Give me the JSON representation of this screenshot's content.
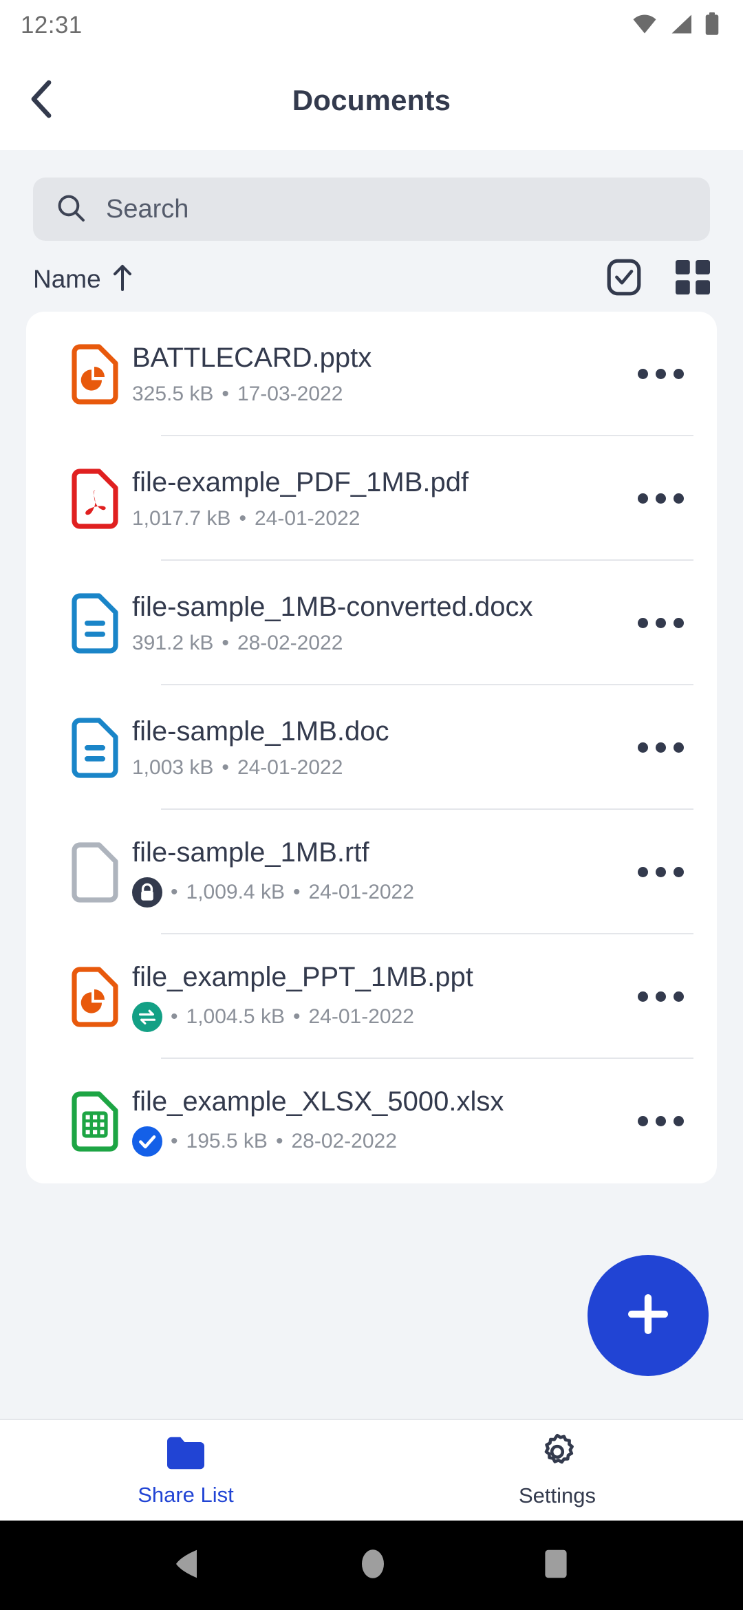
{
  "status_bar": {
    "time": "12:31",
    "icons": [
      "wifi-icon",
      "cellular-signal-icon",
      "battery-icon"
    ]
  },
  "app_bar": {
    "back_icon": "chevron-left-icon",
    "title": "Documents"
  },
  "search": {
    "icon": "search-icon",
    "placeholder": "Search",
    "value": ""
  },
  "sort_row": {
    "label": "Name",
    "direction_icon": "arrow-up-icon",
    "select_icon": "checkbox-select-icon",
    "view_icon": "grid-view-icon"
  },
  "files": [
    {
      "name": "BATTLECARD.pptx",
      "size": "325.5 kB",
      "separator": "•",
      "date": "17-03-2022",
      "icon": "powerpoint-file-icon",
      "icon_color": "#E8590C",
      "badge": null,
      "more_icon": "more-options-icon"
    },
    {
      "name": "file-example_PDF_1MB.pdf",
      "size": "1,017.7 kB",
      "separator": "•",
      "date": "24-01-2022",
      "icon": "pdf-file-icon",
      "icon_color": "#E02020",
      "badge": null,
      "more_icon": "more-options-icon"
    },
    {
      "name": "file-sample_1MB-converted.docx",
      "size": "391.2 kB",
      "separator": "•",
      "date": "28-02-2022",
      "icon": "word-file-icon",
      "icon_color": "#1A85C8",
      "badge": null,
      "more_icon": "more-options-icon"
    },
    {
      "name": "file-sample_1MB.doc",
      "size": "1,003 kB",
      "separator": "•",
      "date": "24-01-2022",
      "icon": "word-file-icon",
      "icon_color": "#1A85C8",
      "badge": null,
      "more_icon": "more-options-icon"
    },
    {
      "name": "file-sample_1MB.rtf",
      "size": "1,009.4 kB",
      "separator": "•",
      "date": "24-01-2022",
      "icon": "generic-file-icon",
      "icon_color": "#AEB4BD",
      "badge": "lock-badge-icon",
      "badge_color": "#333A4D",
      "more_icon": "more-options-icon"
    },
    {
      "name": "file_example_PPT_1MB.ppt",
      "size": "1,004.5 kB",
      "separator": "•",
      "date": "24-01-2022",
      "icon": "powerpoint-file-icon",
      "icon_color": "#E8590C",
      "badge": "sync-badge-icon",
      "badge_color": "#13A085",
      "more_icon": "more-options-icon"
    },
    {
      "name": "file_example_XLSX_5000.xlsx",
      "size": "195.5 kB",
      "separator": "•",
      "date": "28-02-2022",
      "icon": "excel-file-icon",
      "icon_color": "#1DA544",
      "badge": "check-badge-icon",
      "badge_color": "#1460E8",
      "more_icon": "more-options-icon"
    }
  ],
  "fab": {
    "icon": "plus-icon",
    "color": "#2144D4"
  },
  "bottom_nav": {
    "items": [
      {
        "label": "Share List",
        "icon": "folder-icon",
        "active": true
      },
      {
        "label": "Settings",
        "icon": "gear-icon",
        "active": false
      }
    ],
    "active_color": "#2144D4",
    "inactive_color": "#333A4D"
  },
  "android_nav": {
    "back_icon": "android-back-icon",
    "home_icon": "android-home-icon",
    "recents_icon": "android-recents-icon"
  }
}
